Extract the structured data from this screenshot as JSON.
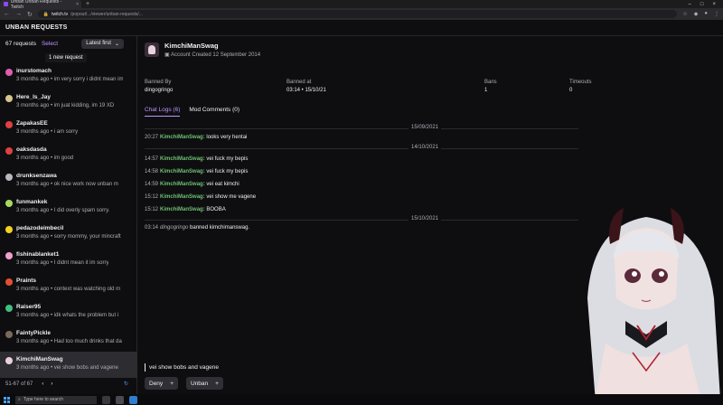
{
  "browser": {
    "tab_title": "Unban Unban Requests - Twitch",
    "url_host": "twitch.tv",
    "url_path": "/popout/.../viewer/unban-requests/...",
    "new_tab": "+"
  },
  "page": {
    "title": "UNBAN REQUESTS"
  },
  "sidebar": {
    "count": "67 requests",
    "select_label": "Select",
    "sort_label": "Latest first",
    "tooltip": "1 new request",
    "pagination": "51-67 of 67",
    "items": [
      {
        "user": "inurstomach",
        "meta": "3 months ago • im very sorry i didnt mean im",
        "color": "#e05db0"
      },
      {
        "user": "Here_Is_Jay",
        "meta": "3 months ago • im juat kidding, im 19 XD",
        "color": "#d9c38f"
      },
      {
        "user": "ZapakasEE",
        "meta": "3 months ago • i am sorry",
        "color": "#e04040"
      },
      {
        "user": "oaksdasda",
        "meta": "3 months ago • im good",
        "color": "#e04040"
      },
      {
        "user": "drunksenzawa",
        "meta": "3 months ago • ok nice work now unban m",
        "color": "#b8b8c0"
      },
      {
        "user": "funmankek",
        "meta": "3 months ago • I did overly spam sorry.",
        "color": "#a8d860"
      },
      {
        "user": "pedazodeimbecil",
        "meta": "3 months ago • sorry mommy, your mincraft",
        "color": "#f5d020"
      },
      {
        "user": "fishinablanket1",
        "meta": "3 months ago • I didnt mean it im sorry",
        "color": "#f0a0d0"
      },
      {
        "user": "Praints",
        "meta": "3 months ago • context was watching old m",
        "color": "#e05030"
      },
      {
        "user": "Raiser95",
        "meta": "3 months ago • idk whats the problem but i",
        "color": "#40c080"
      },
      {
        "user": "FaintyPickle",
        "meta": "3 months ago • Had too much drinks that da",
        "color": "#7a6a5a"
      },
      {
        "user": "KimchiManSwag",
        "meta": "3 months ago • vei show bobs and vagene",
        "color": "#e8d2dc"
      }
    ]
  },
  "detail": {
    "username": "KimchiManSwag",
    "account_created": "Account Created 12 September 2014",
    "banned_by_label": "Banned By",
    "banned_by": "dingogringo",
    "banned_at_label": "Banned at",
    "banned_at": "03:14 • 15/10/21",
    "bans_label": "Bans",
    "bans": "1",
    "timeouts_label": "Timeouts",
    "timeouts": "0",
    "tab_chat": "Chat Logs (6)",
    "tab_mod": "Mod Comments (0)",
    "dates": [
      "15/09/2021",
      "14/10/2021",
      "15/10/2021"
    ],
    "messages": [
      {
        "time": "20:27",
        "user": "KimchiManSwag:",
        "text": " looks very hentai"
      },
      {
        "time": "14:57",
        "user": "KimchiManSwag:",
        "text": " vei fuck my bepis"
      },
      {
        "time": "14:58",
        "user": "KimchiManSwag:",
        "text": " vei fuck my bepis"
      },
      {
        "time": "14:59",
        "user": "KimchiManSwag:",
        "text": " vei eat kimchi"
      },
      {
        "time": "15:12",
        "user": "KimchiManSwag:",
        "text": " vei show me vagene"
      },
      {
        "time": "15:12",
        "user": "KimchiManSwag:",
        "text": " BOOBA"
      }
    ],
    "mod_action": {
      "time": "03:14",
      "mod": "dingogringo",
      "text": " banned kimchimanswag."
    },
    "request_text": "vei show bobs and vagene",
    "deny_label": "Deny",
    "unban_label": "Unban"
  },
  "taskbar": {
    "search_placeholder": "Type here to search"
  }
}
